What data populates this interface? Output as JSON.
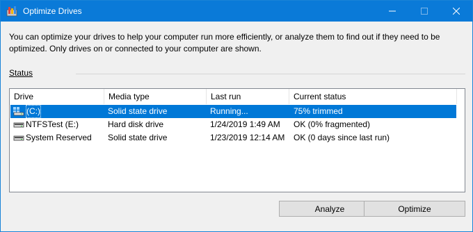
{
  "window": {
    "title": "Optimize Drives",
    "icon": "optimize-drives-icon",
    "controls": [
      "minimize-icon",
      "maximize-icon",
      "close-icon"
    ]
  },
  "description": "You can optimize your drives to help your computer run more efficiently, or analyze them to find out if they need to be optimized. Only drives on or connected to your computer are shown.",
  "status": {
    "label": "Status",
    "columns": [
      "Drive",
      "Media type",
      "Last run",
      "Current status"
    ],
    "rows": [
      {
        "icon": "windows-drive-icon",
        "drive": "(C:)",
        "media_type": "Solid state drive",
        "last_run": "Running...",
        "current_status": "75% trimmed",
        "selected": true
      },
      {
        "icon": "hard-drive-icon",
        "drive": "NTFSTest (E:)",
        "media_type": "Hard disk drive",
        "last_run": "1/24/2019 1:49 AM",
        "current_status": "OK (0% fragmented)",
        "selected": false
      },
      {
        "icon": "hard-drive-icon",
        "drive": "System Reserved",
        "media_type": "Solid state drive",
        "last_run": "1/23/2019 12:14 AM",
        "current_status": "OK (0 days since last run)",
        "selected": false
      }
    ]
  },
  "buttons": {
    "analyze": "Analyze",
    "optimize": "Optimize"
  },
  "colors": {
    "titlebar": "#0a7ad8",
    "selection": "#0078d7",
    "window_bg": "#f0f0f0"
  }
}
